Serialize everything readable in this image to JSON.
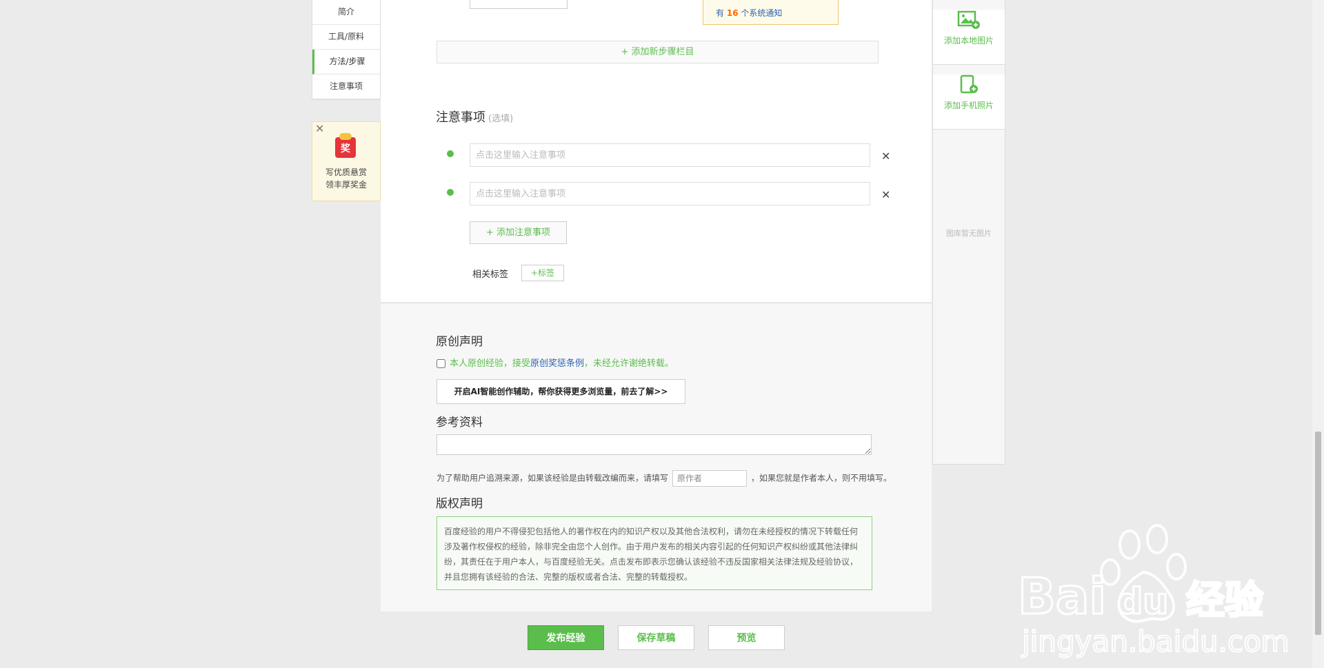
{
  "left_nav": {
    "items": [
      {
        "label": "简介"
      },
      {
        "label": "工具/原料"
      },
      {
        "label": "方法/步骤"
      },
      {
        "label": "注意事项"
      }
    ],
    "active_index": 2
  },
  "promo": {
    "badge": "奖",
    "line1": "写优质悬赏",
    "line2": "领丰厚奖金"
  },
  "notification": {
    "prefix": "有",
    "count": "16",
    "suffix": "个系统通知"
  },
  "add_step_section": "+ 添加新步骤栏目",
  "notes": {
    "title": "注意事项",
    "optional": "(选填)",
    "placeholder": "点击这里输入注意事项",
    "add_label": "+ 添加注意事项"
  },
  "tags": {
    "label": "相关标签",
    "add_label": "+标签"
  },
  "original": {
    "title": "原创声明",
    "text_before": "本人原创经验，接受",
    "link": "原创奖惩条例",
    "text_after": "，未经允许谢绝转载。",
    "ai_button": "开启AI智能创作辅助，帮你获得更多浏览量，前去了解>>"
  },
  "reference": {
    "title": "参考资料",
    "hint_before": "为了帮助用户追溯来源，如果该经验是由转载改编而来，请填写",
    "author_placeholder": "原作者",
    "hint_after": "，如果您就是作者本人，则不用填写。"
  },
  "copyright": {
    "title": "版权声明",
    "text": "百度经验的用户不得侵犯包括他人的著作权在内的知识产权以及其他合法权利，请勿在未经授权的情况下转载任何涉及著作权侵权的经验，除非完全由您个人创作。由于用户发布的相关内容引起的任何知识产权纠纷或其他法律纠纷，其责任在于用户本人，与百度经验无关。点击发布即表示您确认该经验不违反国家相关法律法规及经验协议，并且您拥有该经验的合法、完整的版权或者合法、完整的转载授权。"
  },
  "actions": {
    "publish": "发布经验",
    "save_draft": "保存草稿",
    "preview": "预览"
  },
  "right_panel": {
    "add_local": "添加本地图片",
    "add_phone": "添加手机照片",
    "empty": "图库暂无图片"
  },
  "watermark": {
    "brand": "Bai",
    "brand2": "du",
    "cn": "经验",
    "url": "jingyan.baidu.com"
  },
  "colors": {
    "accent": "#5bbd4c",
    "link": "#2d64b3"
  }
}
